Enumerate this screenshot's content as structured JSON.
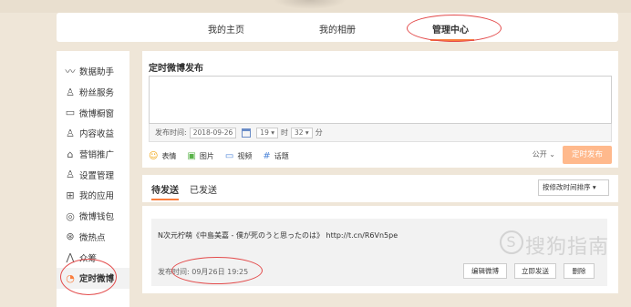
{
  "nav": {
    "items": [
      "我的主页",
      "我的相册",
      "管理中心"
    ],
    "active": "管理中心"
  },
  "sidebar": {
    "items": [
      {
        "label": "数据助手",
        "icon": "chart-line-icon"
      },
      {
        "label": "粉丝服务",
        "icon": "user-icon"
      },
      {
        "label": "微博橱窗",
        "icon": "window-icon"
      },
      {
        "label": "内容收益",
        "icon": "user-coin-icon"
      },
      {
        "label": "营销推广",
        "icon": "bag-icon"
      },
      {
        "label": "设置管理",
        "icon": "user-settings-icon"
      },
      {
        "label": "我的应用",
        "icon": "grid-icon"
      },
      {
        "label": "微博钱包",
        "icon": "wallet-icon"
      },
      {
        "label": "微热点",
        "icon": "hotspot-icon"
      },
      {
        "label": "众筹",
        "icon": "crowdfund-icon"
      },
      {
        "label": "定时微博",
        "icon": "timer-icon"
      }
    ],
    "active": "定时微博"
  },
  "composer": {
    "title": "定时微博发布",
    "textarea_value": "",
    "time_label": "发布时间:",
    "date_value": "2018-09-26",
    "hour_value": "19 ▾",
    "hour_unit": "时",
    "minute_value": "32 ▾",
    "minute_unit": "分",
    "tools": [
      {
        "label": "表情",
        "icon": "emoji-icon"
      },
      {
        "label": "图片",
        "icon": "image-icon"
      },
      {
        "label": "视频",
        "icon": "video-icon"
      },
      {
        "label": "话题",
        "icon": "hashtag-icon"
      }
    ],
    "visibility": "公开 ⌄",
    "publish_label": "定时发布"
  },
  "tabs": {
    "items": [
      "待发送",
      "已发送"
    ],
    "active": "待发送",
    "sort_label": "按修改时间排序 ▾"
  },
  "post": {
    "text": "N次元柠萌《中島美嘉 - 僕が死のうと思ったのは》 http://t.cn/R6Vn5pe",
    "time_label": "发布时间:",
    "time_value": "09月26日 19:25",
    "buttons": [
      "编辑微博",
      "立即发送",
      "删除"
    ]
  },
  "watermark": {
    "symbol": "S",
    "text": "搜狗指南"
  },
  "colors": {
    "accent": "#fa7d3c",
    "publish_button": "#ffb98c",
    "annotation": "#e34b4b"
  }
}
